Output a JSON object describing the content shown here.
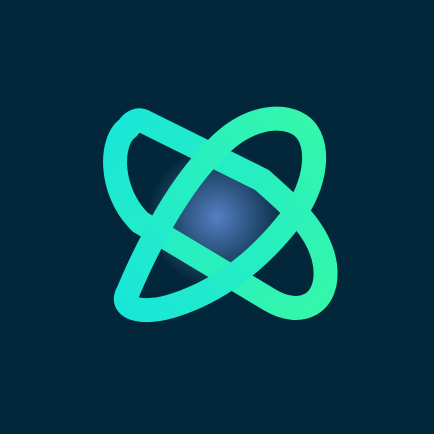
{
  "app_icon": {
    "background_color": "#03273a",
    "logo": {
      "icon": "x-logo-icon",
      "gradient_start": "#19e6d9",
      "gradient_end": "#36f7a8",
      "overlap_tint": "#6f9df0"
    }
  }
}
